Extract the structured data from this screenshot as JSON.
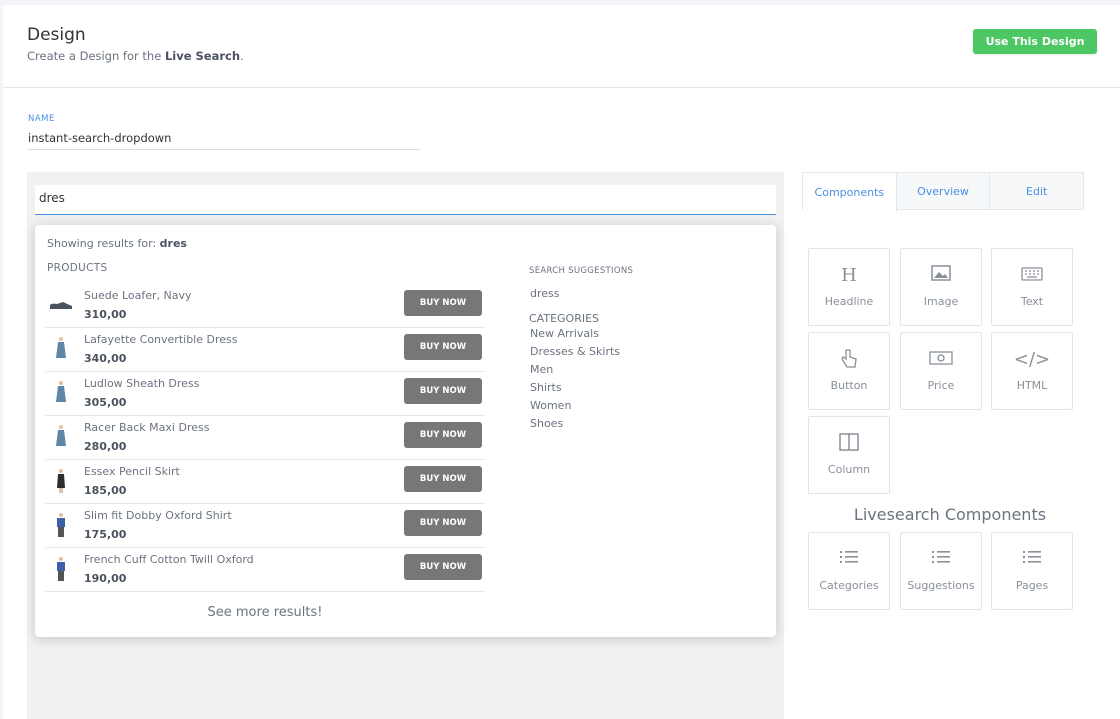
{
  "header": {
    "title": "Design",
    "subtitle_prefix": "Create a Design for the ",
    "subtitle_bold": "Live Search",
    "subtitle_suffix": ".",
    "use_button": "Use This Design"
  },
  "name_field": {
    "label": "NAME",
    "value": "instant-search-dropdown"
  },
  "search": {
    "value": "dres"
  },
  "dropdown": {
    "showing_prefix": "Showing results for: ",
    "showing_query": "dres",
    "products_label": "PRODUCTS",
    "buy_label": "BUY NOW",
    "products": [
      {
        "name": "Suede Loafer, Navy",
        "price": "310,00",
        "icon": "shoe-icon"
      },
      {
        "name": "Lafayette Convertible Dress",
        "price": "340,00",
        "icon": "dress-icon"
      },
      {
        "name": "Ludlow Sheath Dress",
        "price": "305,00",
        "icon": "dress-icon"
      },
      {
        "name": "Racer Back Maxi Dress",
        "price": "280,00",
        "icon": "dress-icon"
      },
      {
        "name": "Essex Pencil Skirt",
        "price": "185,00",
        "icon": "skirt-icon"
      },
      {
        "name": "Slim fit Dobby Oxford Shirt",
        "price": "175,00",
        "icon": "shirt-icon"
      },
      {
        "name": "French Cuff Cotton Twill Oxford",
        "price": "190,00",
        "icon": "shirt-icon"
      }
    ],
    "see_more": "See more results!",
    "suggestions_label": "SEARCH SUGGESTIONS",
    "suggestion": "dress",
    "categories_label": "CATEGORIES",
    "categories": [
      "New Arrivals",
      "Dresses & Skirts",
      "Men",
      "Shirts",
      "Women",
      "Shoes"
    ]
  },
  "tabs": [
    "Components",
    "Overview",
    "Edit"
  ],
  "components": [
    {
      "label": "Headline",
      "icon": "headline-icon"
    },
    {
      "label": "Image",
      "icon": "image-icon"
    },
    {
      "label": "Text",
      "icon": "keyboard-icon"
    },
    {
      "label": "Button",
      "icon": "pointer-icon"
    },
    {
      "label": "Price",
      "icon": "money-icon"
    },
    {
      "label": "HTML",
      "icon": "code-icon"
    },
    {
      "label": "Column",
      "icon": "column-icon"
    }
  ],
  "livesearch_title": "Livesearch Components",
  "livesearch_components": [
    {
      "label": "Categories",
      "icon": "list-icon"
    },
    {
      "label": "Suggestions",
      "icon": "list-icon"
    },
    {
      "label": "Pages",
      "icon": "list-icon"
    }
  ],
  "colors": {
    "accent": "#4a8fe0",
    "success": "#4cc763",
    "buy_button": "#777777"
  }
}
